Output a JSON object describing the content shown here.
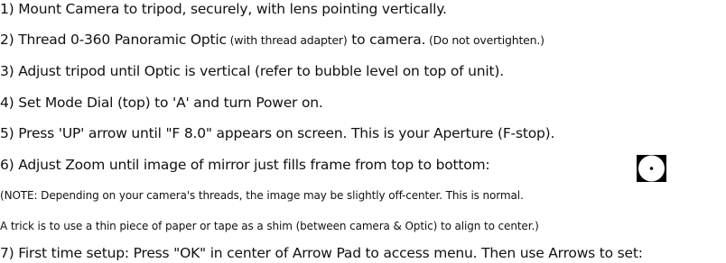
{
  "instructions": {
    "step1": "1) Mount Camera to tripod, securely, with lens pointing vertically.",
    "step2_main": "2) Thread 0-360 Panoramic Optic",
    "step2_adapter": " (with thread adapter)",
    "step2_rest": " to camera.",
    "step2_note": "  (Do not overtighten.)",
    "step3": "3) Adjust tripod until Optic is vertical (refer to bubble level on top of unit).",
    "step4": "4) Set Mode Dial (top) to 'A' and turn Power on.",
    "step5": "5) Press 'UP' arrow until \"F 8.0\" appears on screen. This is your Aperture (F-stop).",
    "step6": "6) Adjust Zoom until image of mirror just fills frame from top to bottom:",
    "note1": "(NOTE:  Depending on your camera's threads, the image may be slightly off-center. This is normal.",
    "note2": "A trick is to use a thin piece of paper or tape as a shim (between camera & Optic) to align to center.)",
    "step7": "7) First time setup:  Press \"OK\" in center of Arrow Pad to access menu. Then use Arrows to set:"
  },
  "colors": {
    "text": "#111111",
    "figure_background": "#000000",
    "figure_disc": "#ffffff"
  }
}
